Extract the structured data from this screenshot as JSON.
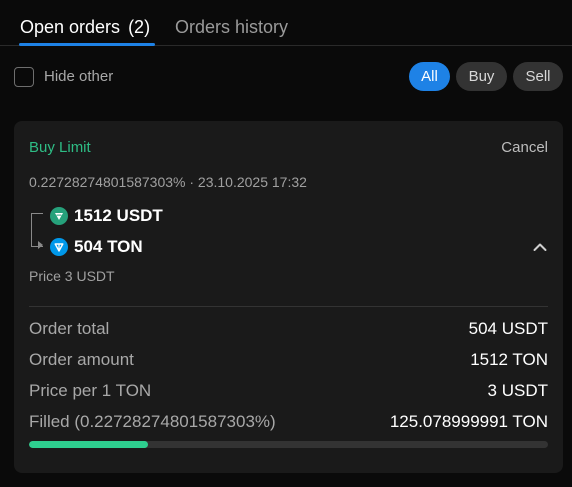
{
  "tabs": {
    "open_label": "Open orders",
    "open_count": "(2)",
    "history_label": "Orders history"
  },
  "filters": {
    "hide_other_label": "Hide other",
    "hide_other_checked": false,
    "all_label": "All",
    "buy_label": "Buy",
    "sell_label": "Sell",
    "selected": "All"
  },
  "order": {
    "type": "Buy Limit",
    "cancel_label": "Cancel",
    "meta": "0.22728274801587303% · 23.10.2025 17:32",
    "from_amount": "1512 USDT",
    "from_icon": "usdt-icon",
    "to_amount": "504 TON",
    "to_icon": "ton-icon",
    "price_line": "Price 3 USDT",
    "details": [
      {
        "label": "Order total",
        "value": "504 USDT"
      },
      {
        "label": "Order amount",
        "value": "1512 TON"
      },
      {
        "label": "Price per 1 TON",
        "value": "3 USDT"
      },
      {
        "label": "Filled (0.22728274801587303%)",
        "value": "125.078999991 TON"
      }
    ],
    "filled_progress_percent": 23,
    "colors": {
      "buy": "#2ebd85",
      "accent": "#1e82e6",
      "progress": "#2ecf8f",
      "usdt": "#26a17b",
      "ton": "#0098ea"
    }
  }
}
